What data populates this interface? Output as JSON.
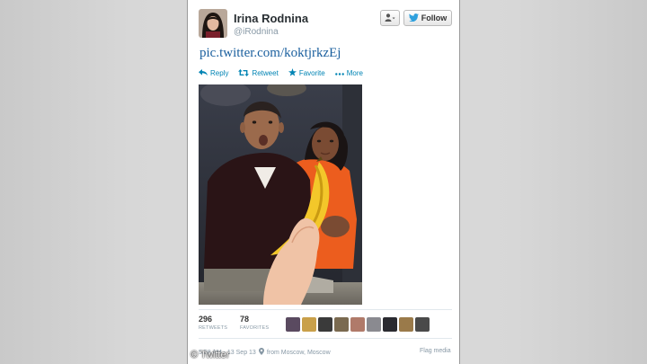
{
  "tweet": {
    "display_name": "Irina Rodnina",
    "handle": "@iRodnina",
    "follow_label": "Follow",
    "link_text": "pic.twitter.com/koktjrkzEj",
    "actions": {
      "reply": "Reply",
      "retweet": "Retweet",
      "favorite": "Favorite",
      "more": "More"
    },
    "stats": {
      "retweets_count": "296",
      "retweets_label": "RETWEETS",
      "favorites_count": "78",
      "favorites_label": "FAVORITES"
    },
    "meta": {
      "time_date": "5:58 AM - 13 Sep 13",
      "location": "from Moscow, Moscow"
    },
    "flag_label": "Flag media"
  },
  "watermark": "© Twitter",
  "colors": {
    "link": "#1a5f9e",
    "action_blue": "#0084b4",
    "twitter_bird": "#2ea0dd",
    "muted_text": "#8899a6"
  },
  "icons": [
    "user-dropdown-icon",
    "twitter-bird-icon",
    "reply-icon",
    "retweet-icon",
    "favorite-star-icon",
    "more-dots-icon",
    "location-pin-icon"
  ]
}
